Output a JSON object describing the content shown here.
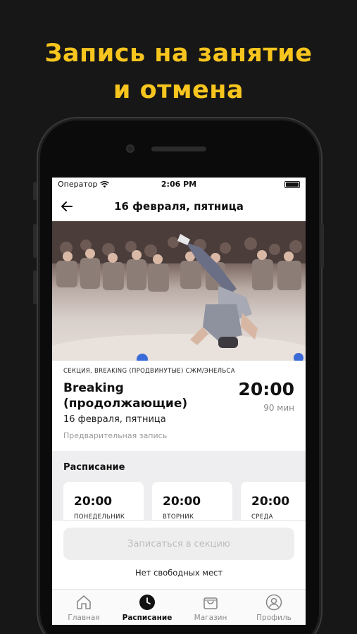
{
  "promo": {
    "line1": "Запись на занятие",
    "line2": "и отмена"
  },
  "status_bar": {
    "carrier": "Оператор",
    "time": "2:06 PM"
  },
  "nav": {
    "title": "16 февраля, пятница",
    "back_icon": "arrow-left-icon"
  },
  "class": {
    "category": "СЕКЦИЯ, BREAKING (ПРОДВИНУТЫЕ) СЖМ/ЭНЕЛЬСА",
    "title_line1": "Breaking",
    "title_line2": "(продолжающие)",
    "time": "20:00",
    "duration": "90 мин",
    "date": "16 февраля, пятница",
    "note": "Предварительная запись"
  },
  "schedule": {
    "title": "Расписание",
    "days": [
      {
        "time": "20:00",
        "day": "ПОНЕДЕЛЬНИК"
      },
      {
        "time": "20:00",
        "day": "ВТОРНИК"
      },
      {
        "time": "20:00",
        "day": "СРЕДА"
      }
    ]
  },
  "actions": {
    "signup_label": "Записаться в секцию",
    "no_seats": "Нет свободных мест"
  },
  "tabs": [
    {
      "label": "Главная",
      "icon": "home-icon",
      "active": false
    },
    {
      "label": "Расписание",
      "icon": "clock-icon",
      "active": true
    },
    {
      "label": "Магазин",
      "icon": "shopping-bag-icon",
      "active": false
    },
    {
      "label": "Профиль",
      "icon": "user-icon",
      "active": false
    }
  ],
  "colors": {
    "accent": "#f7c51e",
    "background": "#171717",
    "disabled_button": "#eeeeef"
  }
}
